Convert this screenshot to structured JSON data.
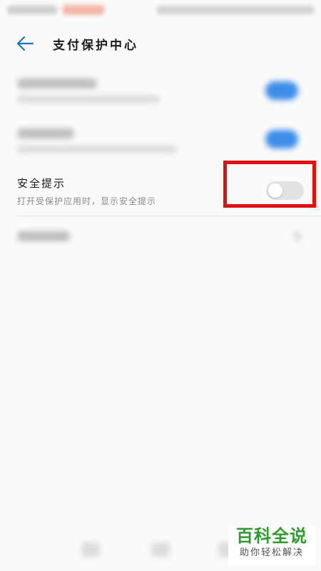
{
  "header": {
    "title": "支付保护中心",
    "back_icon": "arrow-left-icon"
  },
  "security_prompt": {
    "title": "安全提示",
    "subtitle": "打开受保护应用时，显示安全提示",
    "toggle_state": "off"
  },
  "colors": {
    "back_arrow": "#1a73c8",
    "highlight": "#e01010",
    "toggle_on": "#3d8de8",
    "toggle_off": "#e2e2e2",
    "watermark_green": "#2f9a2f"
  },
  "watermark": {
    "main": "百科全说",
    "sub": "助你轻松解决"
  }
}
